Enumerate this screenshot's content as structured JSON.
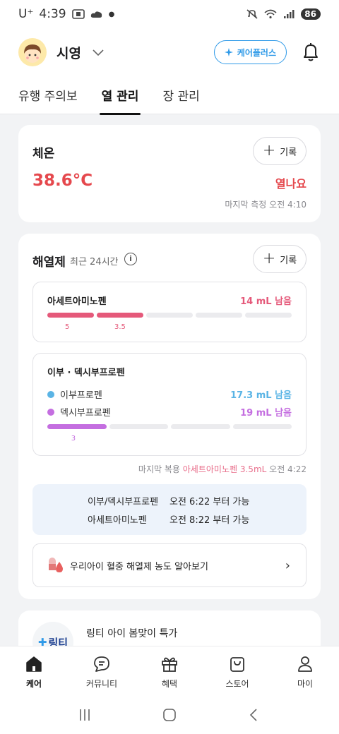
{
  "status_bar": {
    "carrier": "U⁺",
    "time": "4:39",
    "battery": "86"
  },
  "header": {
    "username": "시영",
    "care_plus_label": "케어플러스"
  },
  "tabs": [
    {
      "label": "유행 주의보"
    },
    {
      "label": "열 관리",
      "active": true
    },
    {
      "label": "장 관리"
    }
  ],
  "temperature": {
    "title": "체온",
    "add_label": "기록",
    "value": "38.6°C",
    "status": "열나요",
    "last_measured": "마지막 측정  오전 4:10"
  },
  "antipyretic": {
    "title": "해열제",
    "subtitle": "최근 24시간",
    "add_label": "기록",
    "acetaminophen": {
      "name": "아세트아미노펜",
      "remaining": "14 mL 남음",
      "doses": [
        "5",
        "3.5"
      ],
      "segments_filled": 2,
      "segments_total": 5,
      "color": "#e5597a"
    },
    "ibu_dexi": {
      "name": "이부 · 덱시부프로펜",
      "ibuprofen_label": "이부프로펜",
      "ibuprofen_remaining": "17.3 mL 남음",
      "ibuprofen_color": "#5ab4e5",
      "dexibuprofen_label": "덱시부프로펜",
      "dexibuprofen_remaining": "19 mL 남음",
      "dexibuprofen_color": "#c46ee0",
      "doses": [
        "3"
      ],
      "segments_filled": 1,
      "segments_total": 4
    },
    "last_dose_prefix": "마지막 복용",
    "last_dose_drug": "아세트아미노펜 3.5mL",
    "last_dose_time": "오전 4:22",
    "availability": [
      {
        "name": "이부/덱시부프로펜",
        "time": "오전 6:22 부터 가능"
      },
      {
        "name": "아세트아미노펜",
        "time": "오전 8:22 부터 가능"
      }
    ],
    "link_label": "우리아이 혈중 해열제 농도 알아보기"
  },
  "promo": {
    "logo_text": "링티",
    "title": "링티 아이 봄맞이 특가"
  },
  "bottom_nav": [
    {
      "label": "케어",
      "icon": "home-icon",
      "active": true
    },
    {
      "label": "커뮤니티",
      "icon": "chat-icon"
    },
    {
      "label": "혜택",
      "icon": "gift-icon"
    },
    {
      "label": "스토어",
      "icon": "bag-icon"
    },
    {
      "label": "마이",
      "icon": "person-icon"
    }
  ]
}
